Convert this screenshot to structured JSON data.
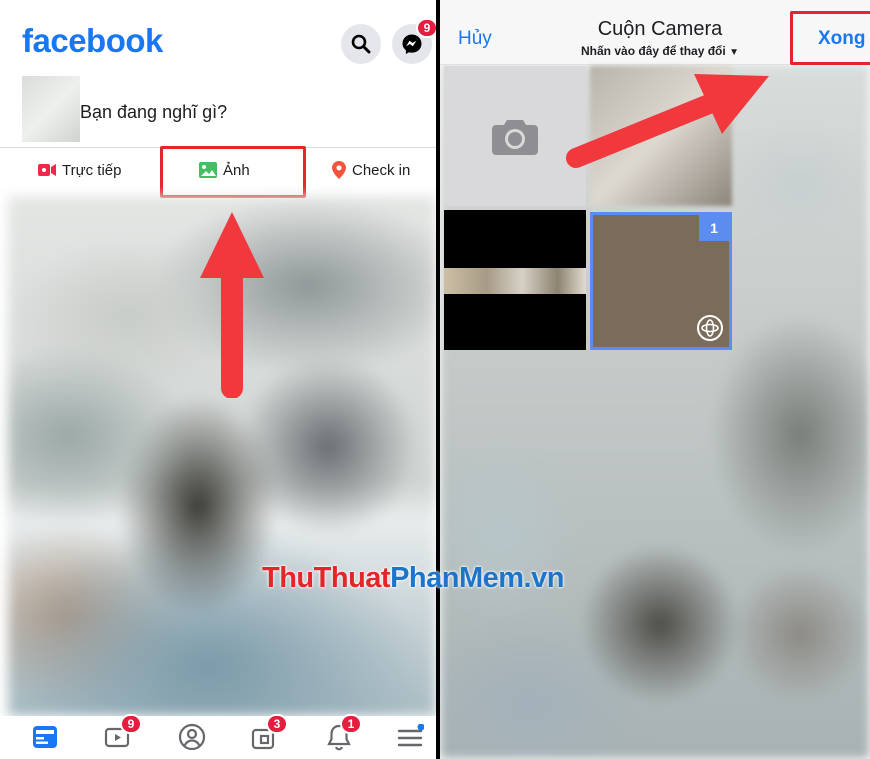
{
  "left": {
    "logo": "facebook",
    "messenger_badge": "9",
    "composer_placeholder": "Bạn đang nghĩ gì?",
    "actions": {
      "live": "Trực tiếp",
      "photo": "Ảnh",
      "checkin": "Check in"
    },
    "tabbar": {
      "watch_badge": "9",
      "groups_badge": "3",
      "notifications_badge": "1"
    }
  },
  "right": {
    "cancel": "Hủy",
    "title": "Cuộn Camera",
    "subtitle": "Nhấn vào đây để thay đổi",
    "done": "Xong",
    "selected_index": "1"
  },
  "watermark": {
    "part1": "ThuThuat",
    "part2": "PhanMem.vn"
  },
  "colors": {
    "facebook_blue": "#1877f2",
    "highlight_red": "#e5252a",
    "arrow_red": "#f0383d",
    "badge_red": "#e41e3f",
    "selection_blue": "#5b8cf0"
  }
}
